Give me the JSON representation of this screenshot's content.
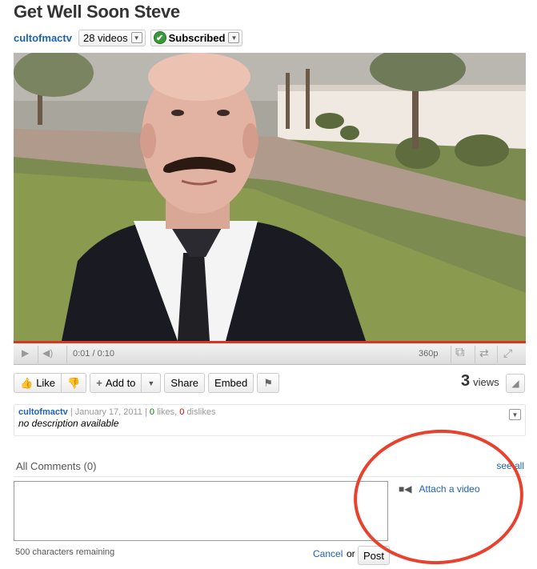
{
  "title": "Get Well Soon Steve",
  "channel": {
    "name": "cultofmactv",
    "videos_label": "28 videos",
    "subscribed_label": "Subscribed"
  },
  "player": {
    "time": "0:01 / 0:10",
    "quality": "360p",
    "progress": 0.1
  },
  "actions": {
    "like": "Like",
    "add_to": "Add to",
    "share": "Share",
    "embed": "Embed"
  },
  "views": {
    "count": "3",
    "label": "views"
  },
  "description": {
    "author": "cultofmactv",
    "date": "January 17, 2011",
    "likes": "0",
    "likes_label": "likes,",
    "dislikes": "0",
    "dislikes_label": "dislikes",
    "text": "no description available"
  },
  "comments": {
    "title": "All Comments (0)",
    "see_all": "see all",
    "attach": "Attach a video",
    "remaining": "500 characters remaining",
    "cancel": "Cancel",
    "or": "or",
    "post": "Post"
  },
  "colors": {
    "link": "#1c62b9",
    "annotation": "#e8412d",
    "progress": "#dd3322"
  },
  "icons": [
    "thumbs-up-icon",
    "thumbs-down-icon",
    "plus-icon",
    "flag-icon",
    "stats-icon",
    "play-icon",
    "volume-icon",
    "popout-icon",
    "size-icon",
    "fullscreen-icon",
    "camera-icon",
    "check-icon",
    "chevron-down-icon"
  ]
}
